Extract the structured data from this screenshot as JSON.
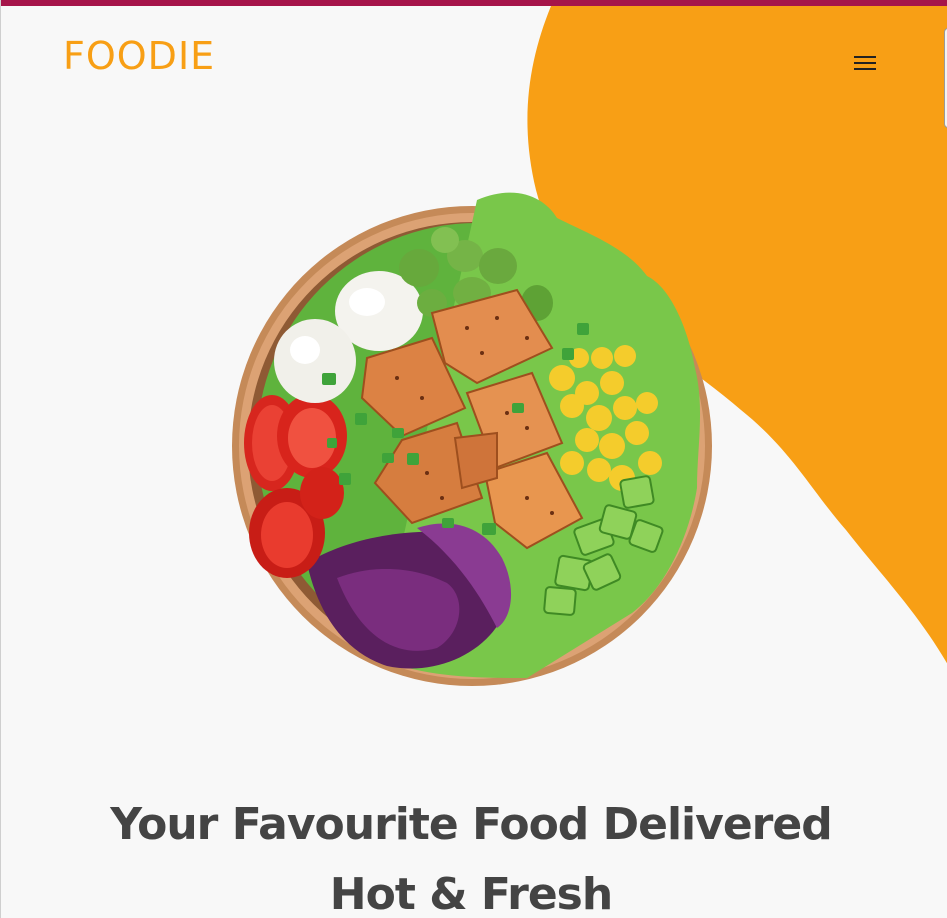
{
  "brand": {
    "logo_text": "FOODIE",
    "accent_color": "#f89f15",
    "top_bar_color": "#a6154a",
    "text_color": "#444444"
  },
  "header": {
    "menu_icon": "hamburger-menu-icon"
  },
  "hero": {
    "image": "food-bowl-image",
    "title_line_1": "Your Favourite Food Delivered",
    "title_line_2": "Hot & Fresh"
  }
}
